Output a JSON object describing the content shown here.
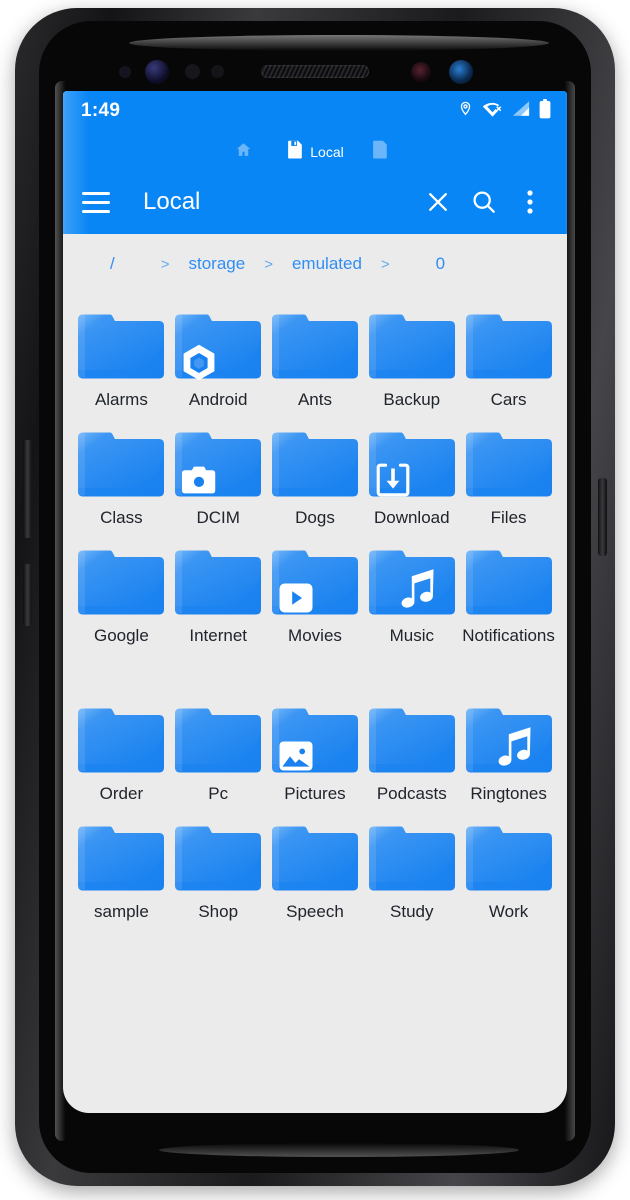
{
  "status_bar": {
    "time": "1:49",
    "icons": [
      "location-pin-icon",
      "wifi-off-icon",
      "cell-signal-icon",
      "battery-icon"
    ]
  },
  "tabs": [
    {
      "label": "",
      "icon": "home-icon",
      "active": false
    },
    {
      "label": "Local",
      "icon": "storage-icon",
      "active": true
    },
    {
      "label": "",
      "icon": "sdcard-icon",
      "active": false
    }
  ],
  "toolbar": {
    "menu_icon": "hamburger-menu-icon",
    "title": "Local",
    "close_label": "close-icon",
    "search_label": "search-icon",
    "overflow_label": "more-vert-icon"
  },
  "breadcrumb": {
    "root": "/",
    "separator": ">",
    "segments": [
      "storage",
      "emulated",
      "0"
    ]
  },
  "colors": {
    "appbar": "#0886f5",
    "folder": "#1a82f0",
    "background": "#ebebeb",
    "breadcrumb_link": "#2f8ef4",
    "label_text": "#20242b"
  },
  "files": [
    {
      "name": "Alarms",
      "badge": "none"
    },
    {
      "name": "Android",
      "badge": "hexagon-icon"
    },
    {
      "name": "Ants",
      "badge": "none"
    },
    {
      "name": "Backup",
      "badge": "none"
    },
    {
      "name": "Cars",
      "badge": "none"
    },
    {
      "name": "Class",
      "badge": "none"
    },
    {
      "name": "DCIM",
      "badge": "camera-icon"
    },
    {
      "name": "Dogs",
      "badge": "none"
    },
    {
      "name": "Download",
      "badge": "download-icon"
    },
    {
      "name": "Files",
      "badge": "none"
    },
    {
      "name": "Google",
      "badge": "none"
    },
    {
      "name": "Internet",
      "badge": "none"
    },
    {
      "name": "Movies",
      "badge": "play-icon"
    },
    {
      "name": "Music",
      "badge": "music-note-icon"
    },
    {
      "name": "Notifications",
      "badge": "none"
    },
    {
      "name": "Order",
      "badge": "none"
    },
    {
      "name": "Pc",
      "badge": "none"
    },
    {
      "name": "Pictures",
      "badge": "image-icon"
    },
    {
      "name": "Podcasts",
      "badge": "none"
    },
    {
      "name": "Ringtones",
      "badge": "music-note-icon"
    },
    {
      "name": "sample",
      "badge": "none"
    },
    {
      "name": "Shop",
      "badge": "none"
    },
    {
      "name": "Speech",
      "badge": "none"
    },
    {
      "name": "Study",
      "badge": "none"
    },
    {
      "name": "Work",
      "badge": "none"
    }
  ]
}
